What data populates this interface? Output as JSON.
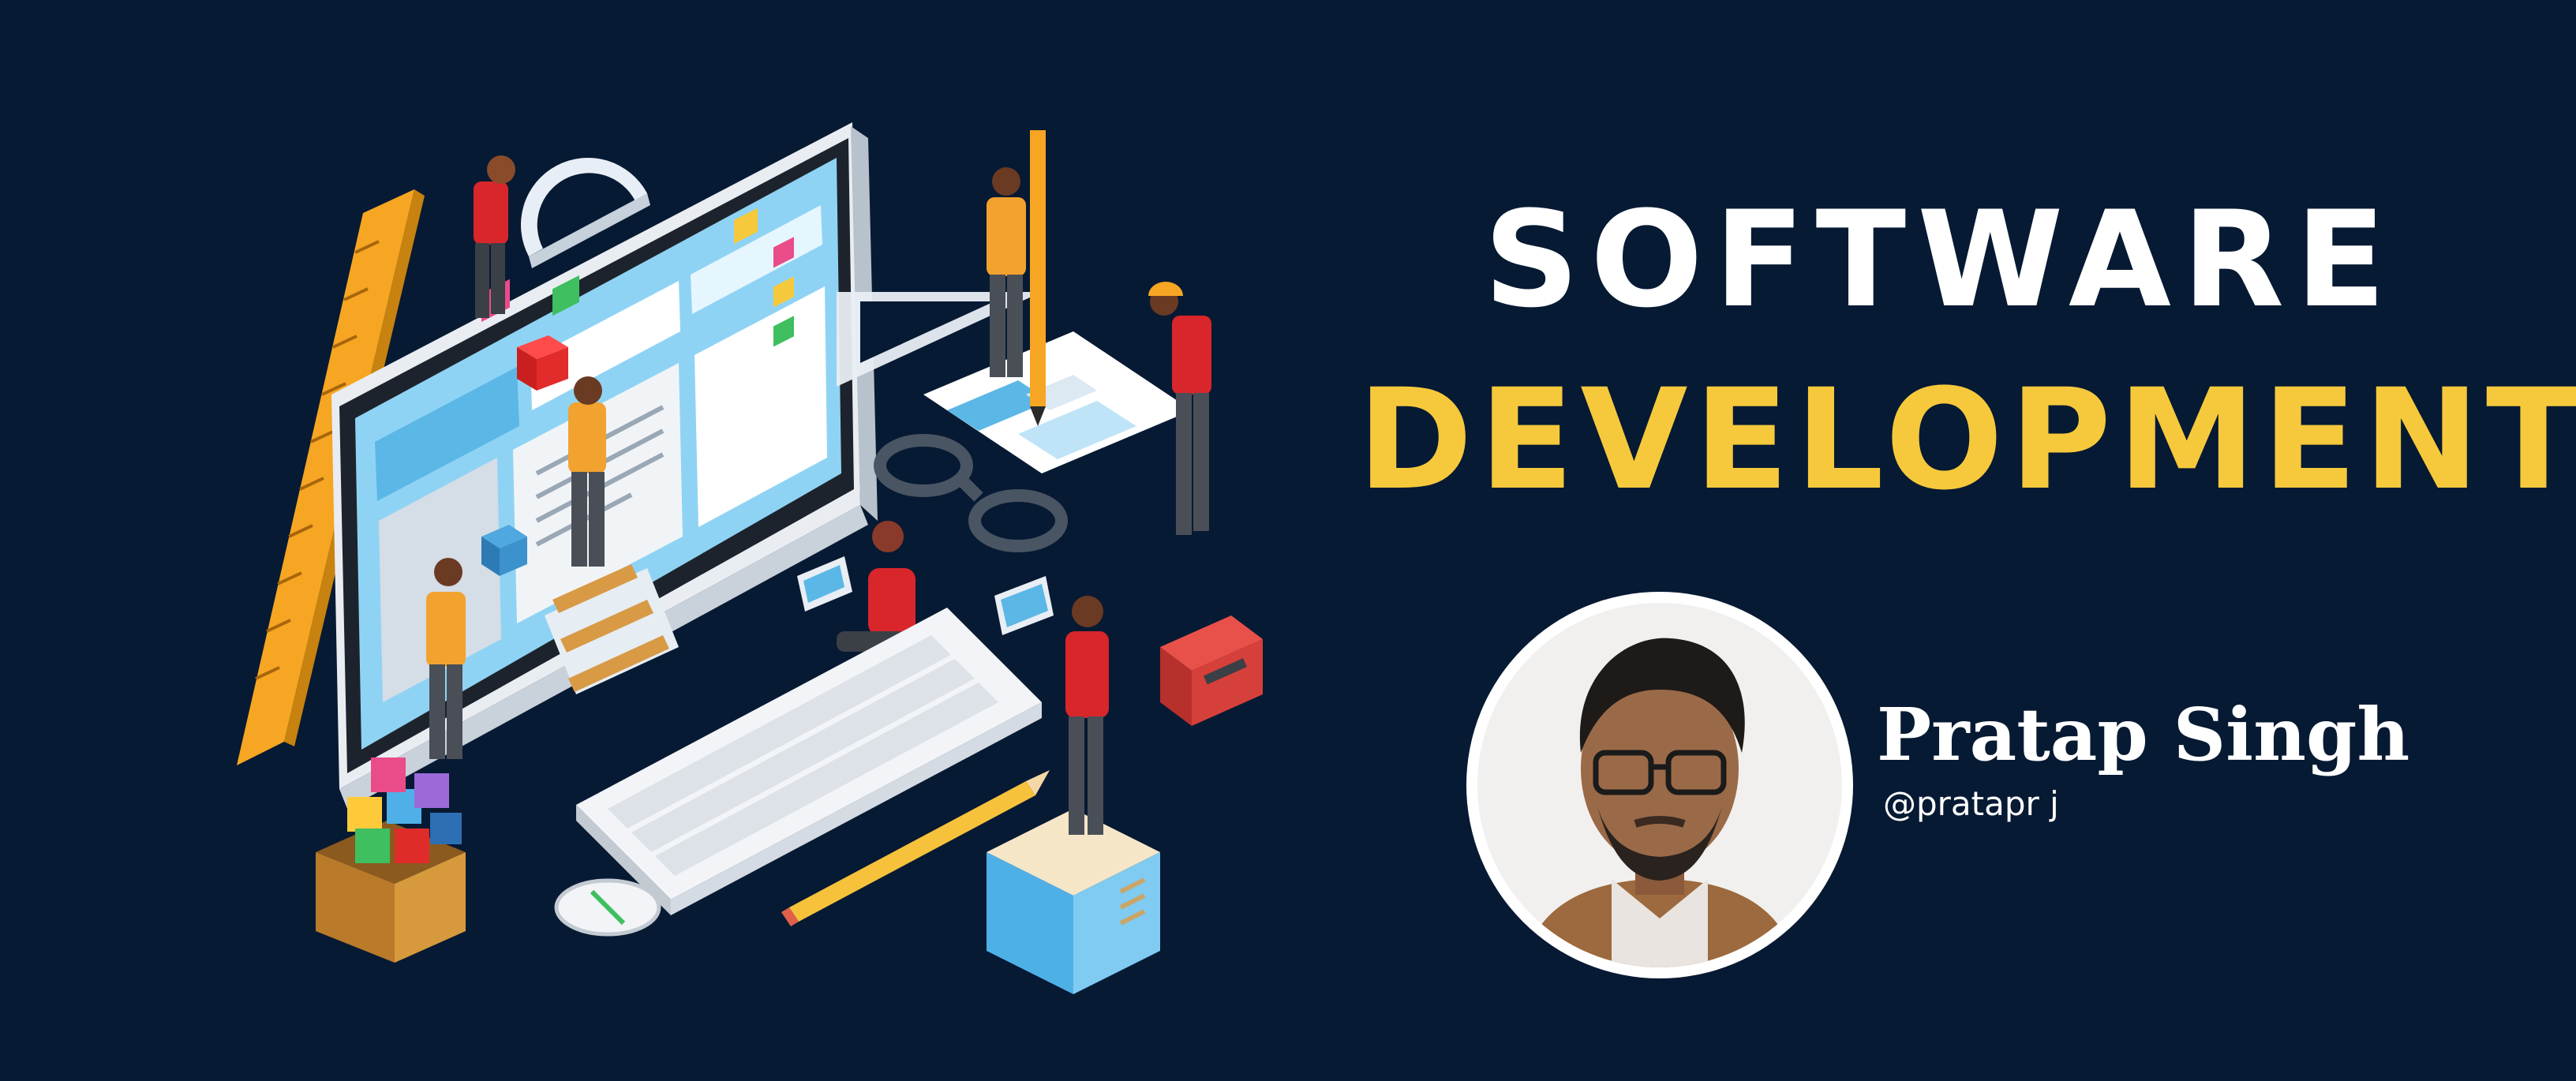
{
  "banner": {
    "title_line1": "SOFTWARE",
    "title_line2": "DEVELOPMENT",
    "author": {
      "name": "Pratap Singh",
      "handle": "@pratapr j"
    }
  },
  "colors": {
    "background": "#071a33",
    "title_line1": "#ffffff",
    "title_line2": "#f6c93c",
    "author_text": "#ffffff"
  },
  "illustration": {
    "subject": "isometric software development team building a website on a desktop monitor",
    "icons": [
      "monitor-icon",
      "keyboard-icon",
      "mouse-icon",
      "pencil-icon",
      "ruler-icon",
      "protractor-icon",
      "glasses-icon",
      "cubes-box-icon",
      "sticky-note-box-icon",
      "stapler-icon",
      "step-ladder-icon"
    ]
  }
}
